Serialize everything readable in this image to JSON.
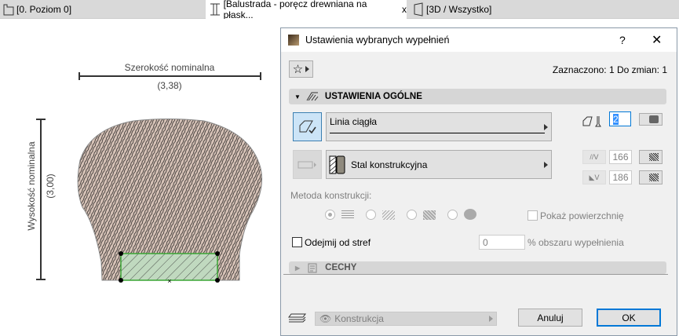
{
  "tabs": [
    {
      "label": "[0. Poziom 0]",
      "icon": "floor-plan-icon"
    },
    {
      "label": "[Balustrada - poręcz drewniana na płask...",
      "icon": "profile-icon",
      "active": true,
      "close": "x"
    },
    {
      "label": "[3D / Wszystko]",
      "icon": "3d-view-icon"
    }
  ],
  "canvas": {
    "width_label": "Szerokość nominalna",
    "width_value": "(3,38)",
    "height_label": "Wysokość nominalna",
    "height_value": "(3,00)"
  },
  "dialog": {
    "title": "Ustawienia wybranych wypełnień",
    "help": "?",
    "close": "✕",
    "status": "Zaznaczono: 1 Do zmian: 1",
    "section_general": "USTAWIENIA OGÓLNE",
    "line_type": "Linia ciągła",
    "pen_value": "2",
    "material": "Stal konstrukcyjna",
    "fg_pen": "166",
    "bg_pen": "186",
    "method_label": "Metoda konstrukcji:",
    "show_surface": "Pokaż powierzchnię",
    "subtract_zones": "Odejmij od stref",
    "percent_value": "0",
    "percent_label": "% obszaru wypełnienia",
    "section_props": "CECHY",
    "layer": "Konstrukcja",
    "cancel": "Anuluj",
    "ok": "OK"
  },
  "colors": {
    "accent": "#0078d7",
    "fill": "#d7c3b8",
    "selection": "#c0d9bf"
  }
}
